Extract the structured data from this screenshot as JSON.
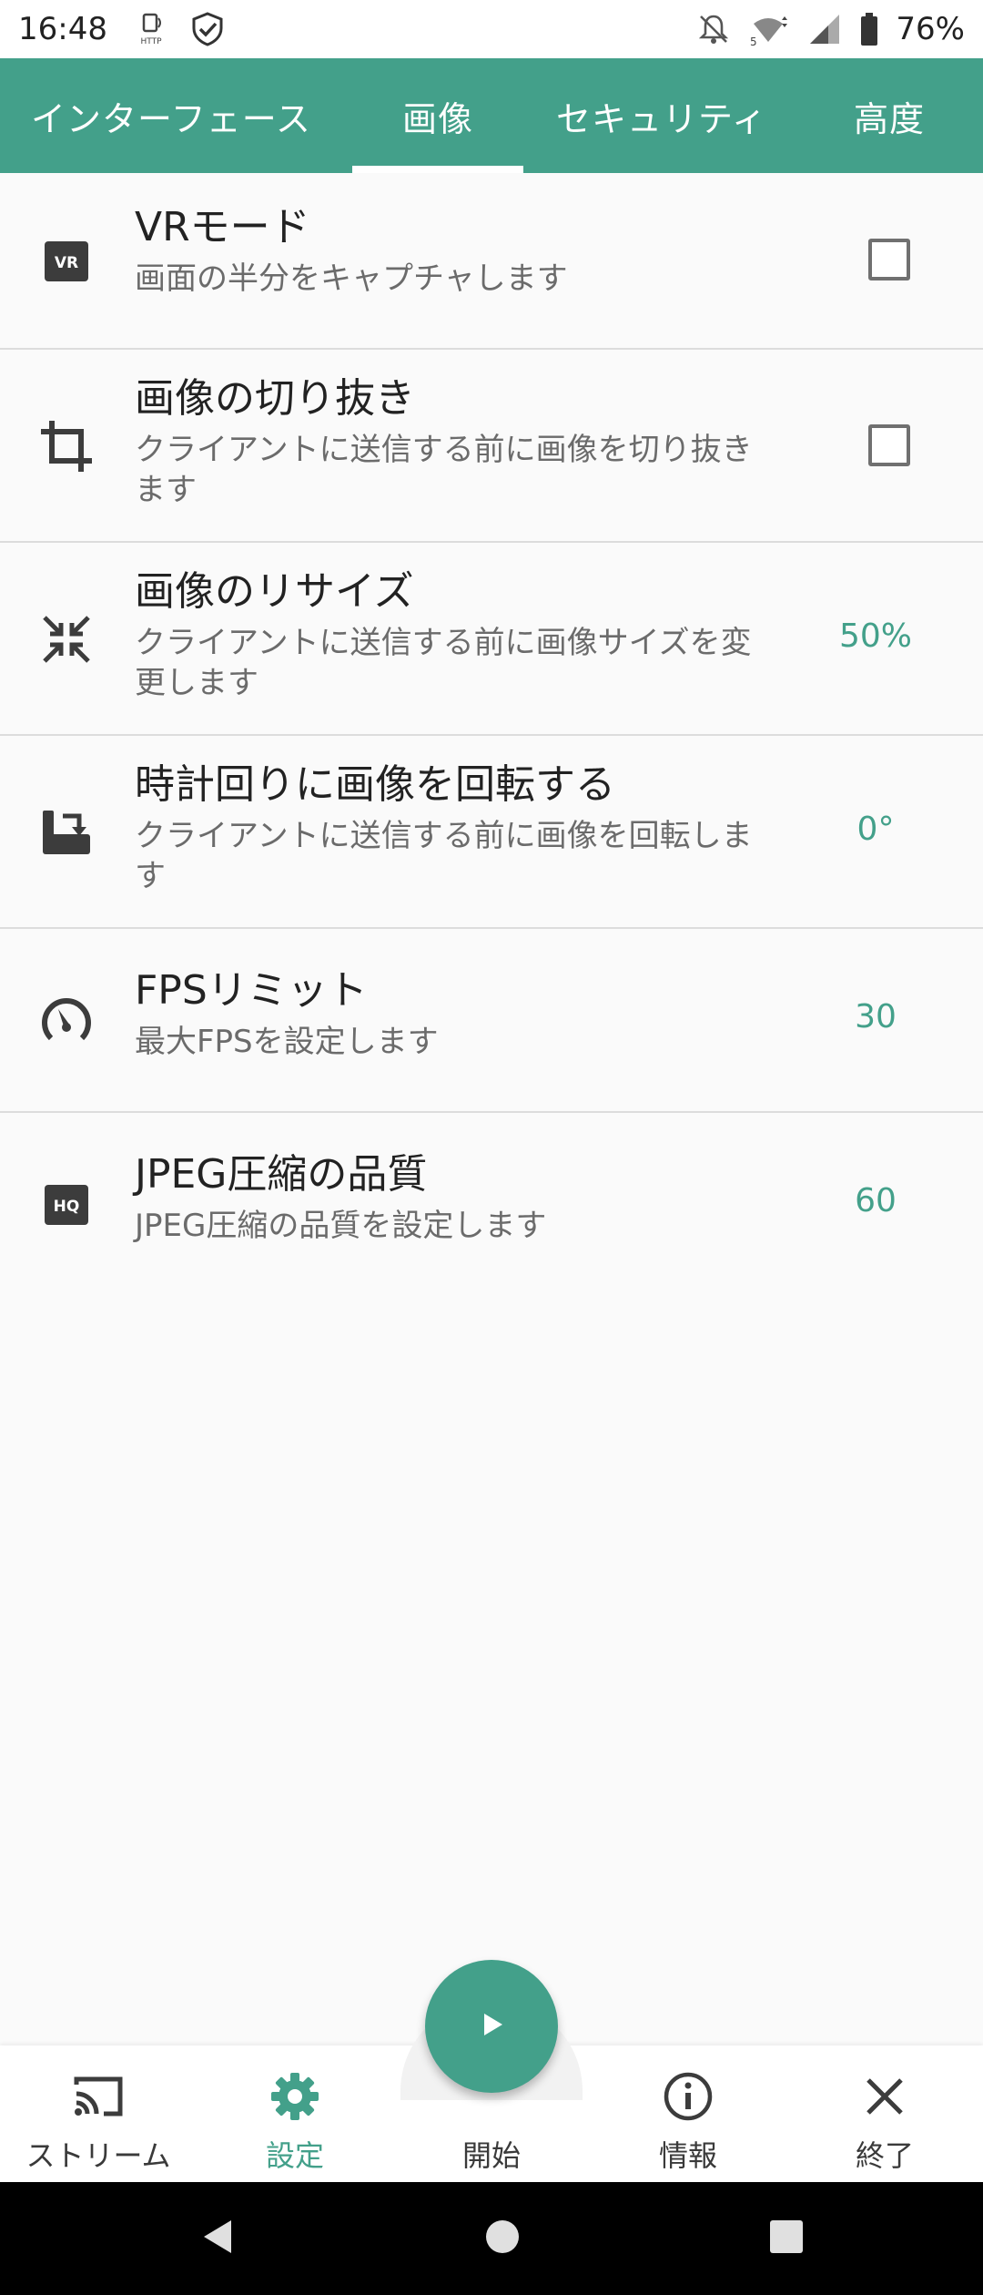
{
  "status_bar": {
    "time": "16:48",
    "battery_percent": "76%",
    "icons": [
      "http-server-icon",
      "shield-check-icon",
      "notifications-off-icon",
      "wifi-5g-icon",
      "cell-signal-icon",
      "battery-icon"
    ]
  },
  "tabs": [
    {
      "label": "インターフェース",
      "active": false
    },
    {
      "label": "画像",
      "active": true
    },
    {
      "label": "セキュリティ",
      "active": false
    },
    {
      "label": "高度",
      "active": false
    }
  ],
  "settings": [
    {
      "icon": "vr-icon",
      "title": "VRモード",
      "subtitle": "画面の半分をキャプチャします",
      "control": "checkbox",
      "checked": false
    },
    {
      "icon": "crop-icon",
      "title": "画像の切り抜き",
      "subtitle_lines": [
        "クライアントに送信する前に画像を切り抜き",
        "ます"
      ],
      "control": "checkbox",
      "checked": false
    },
    {
      "icon": "resize-icon",
      "title": "画像のリサイズ",
      "subtitle_lines": [
        "クライアントに送信する前に画像サイズを変",
        "更します"
      ],
      "value": "50%"
    },
    {
      "icon": "rotate-icon",
      "title": "時計回りに画像を回転する",
      "subtitle_lines": [
        "クライアントに送信する前に画像を回転しま",
        "す"
      ],
      "value": "0°"
    },
    {
      "icon": "speedometer-icon",
      "title": "FPSリミット",
      "subtitle": "最大FPSを設定します",
      "value": "30"
    },
    {
      "icon": "hq-icon",
      "title": "JPEG圧縮の品質",
      "subtitle": "JPEG圧縮の品質を設定します",
      "value": "60"
    }
  ],
  "bottom_nav": [
    {
      "icon": "cast-icon",
      "label": "ストリーム",
      "active": false
    },
    {
      "icon": "gear-icon",
      "label": "設定",
      "active": true
    },
    {
      "icon": "play-icon",
      "label": "開始",
      "active": false
    },
    {
      "icon": "info-icon",
      "label": "情報",
      "active": false
    },
    {
      "icon": "close-icon",
      "label": "終了",
      "active": false
    }
  ],
  "system_nav": [
    "back-icon",
    "home-icon",
    "recents-icon"
  ],
  "colors": {
    "accent": "#43a08a",
    "text": "#222222",
    "subtext": "#6b6b6b",
    "divider": "#dcdcdc"
  }
}
